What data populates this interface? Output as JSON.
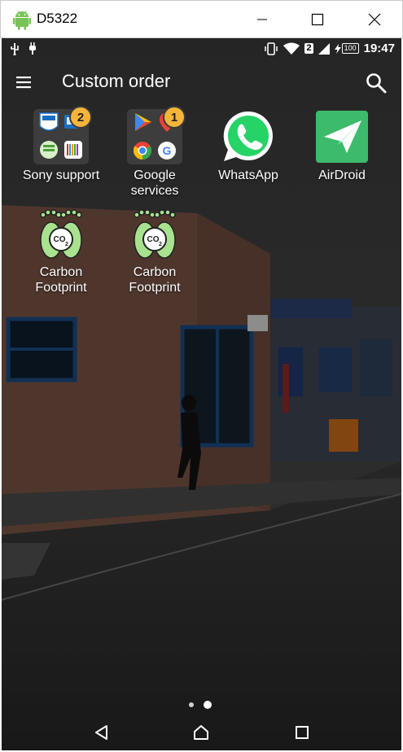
{
  "window": {
    "title": "D5322",
    "controls": {
      "minimize_icon": "minimize-icon",
      "maximize_icon": "maximize-icon",
      "close_icon": "close-icon"
    }
  },
  "statusbar": {
    "left_icons": [
      "usb-icon",
      "plug-icon"
    ],
    "right_icons": [
      "vibrate-icon",
      "wifi-icon",
      "sim-icon",
      "signal-icon",
      "battery-icon"
    ],
    "sim_slot": "2",
    "battery_level": "100",
    "time": "19:47"
  },
  "appbar": {
    "title": "Custom order",
    "menu_icon": "hamburger-menu-icon",
    "search_icon": "search-icon"
  },
  "apps": [
    {
      "label": "Sony support",
      "type": "folder",
      "badge": "2"
    },
    {
      "label": "Google services",
      "type": "folder",
      "badge": "1"
    },
    {
      "label": "WhatsApp",
      "type": "app"
    },
    {
      "label": "AirDroid",
      "type": "app"
    },
    {
      "label": "Carbon Footprint",
      "type": "app"
    },
    {
      "label": "Carbon Footprint",
      "type": "app"
    }
  ],
  "pager": {
    "pages": 2,
    "current": 2
  },
  "navbar": {
    "back_icon": "back-icon",
    "home_icon": "home-icon",
    "recents_icon": "recents-icon"
  },
  "colors": {
    "badge": "#f6b43a",
    "whatsapp": "#25d366",
    "airdroid": "#3dbb6c",
    "carbon_feet": "#a9e28f",
    "android_logo": "#78c257"
  }
}
